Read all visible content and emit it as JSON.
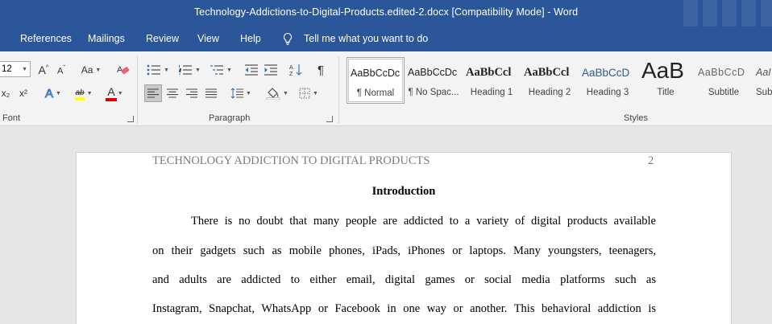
{
  "window": {
    "title": "Technology-Addictions-to-Digital-Products.edited-2.docx [Compatibility Mode]  -  Word"
  },
  "tabs": [
    {
      "label": "References"
    },
    {
      "label": "Mailings"
    },
    {
      "label": "Review"
    },
    {
      "label": "View"
    },
    {
      "label": "Help"
    }
  ],
  "tell_me": {
    "placeholder": "Tell me what you want to do",
    "icon": "lightbulb-icon"
  },
  "ribbon": {
    "font": {
      "size_value": "12",
      "case_label": "Aa",
      "subscript": "x₂",
      "superscript": "x²",
      "text_effects": "A",
      "highlight": "ab",
      "font_color": "A",
      "group_label": "Font",
      "highlight_color": "#ffff00",
      "font_color_value": "#e00000"
    },
    "paragraph": {
      "group_label": "Paragraph",
      "pilcrow": "¶"
    },
    "styles": {
      "group_label": "Styles",
      "items": [
        {
          "sample": "AaBbCcDc",
          "name": "¶ Normal"
        },
        {
          "sample": "AaBbCcDc",
          "name": "¶ No Spac..."
        },
        {
          "sample": "AaBbCcl",
          "name": "Heading 1"
        },
        {
          "sample": "AaBbCcl",
          "name": "Heading 2"
        },
        {
          "sample": "AaBbCcD",
          "name": "Heading 3"
        },
        {
          "sample": "AaB",
          "name": "Title"
        },
        {
          "sample": "AaBbCcD",
          "name": "Subtitle"
        },
        {
          "sample": "AaI",
          "name": "Sub"
        }
      ]
    }
  },
  "document": {
    "header": "TECHNOLOGY ADDICTION TO DIGITAL PRODUCTS",
    "page_number": "2",
    "heading": "Introduction",
    "lines": [
      "There is no doubt that many people are addicted to a variety of digital products available",
      "on their gadgets such as mobile phones, iPads, iPhones or laptops. Many youngsters, teenagers,",
      "and adults are addicted to either email, digital games or social media platforms such as",
      "Instagram, Snapchat, WhatsApp or Facebook in one way or another. This behavioral addiction is"
    ]
  },
  "colors": {
    "ribbon_blue": "#2b579a",
    "ribbon_body": "#f3f3f3",
    "workspace": "#e6e6e6"
  }
}
